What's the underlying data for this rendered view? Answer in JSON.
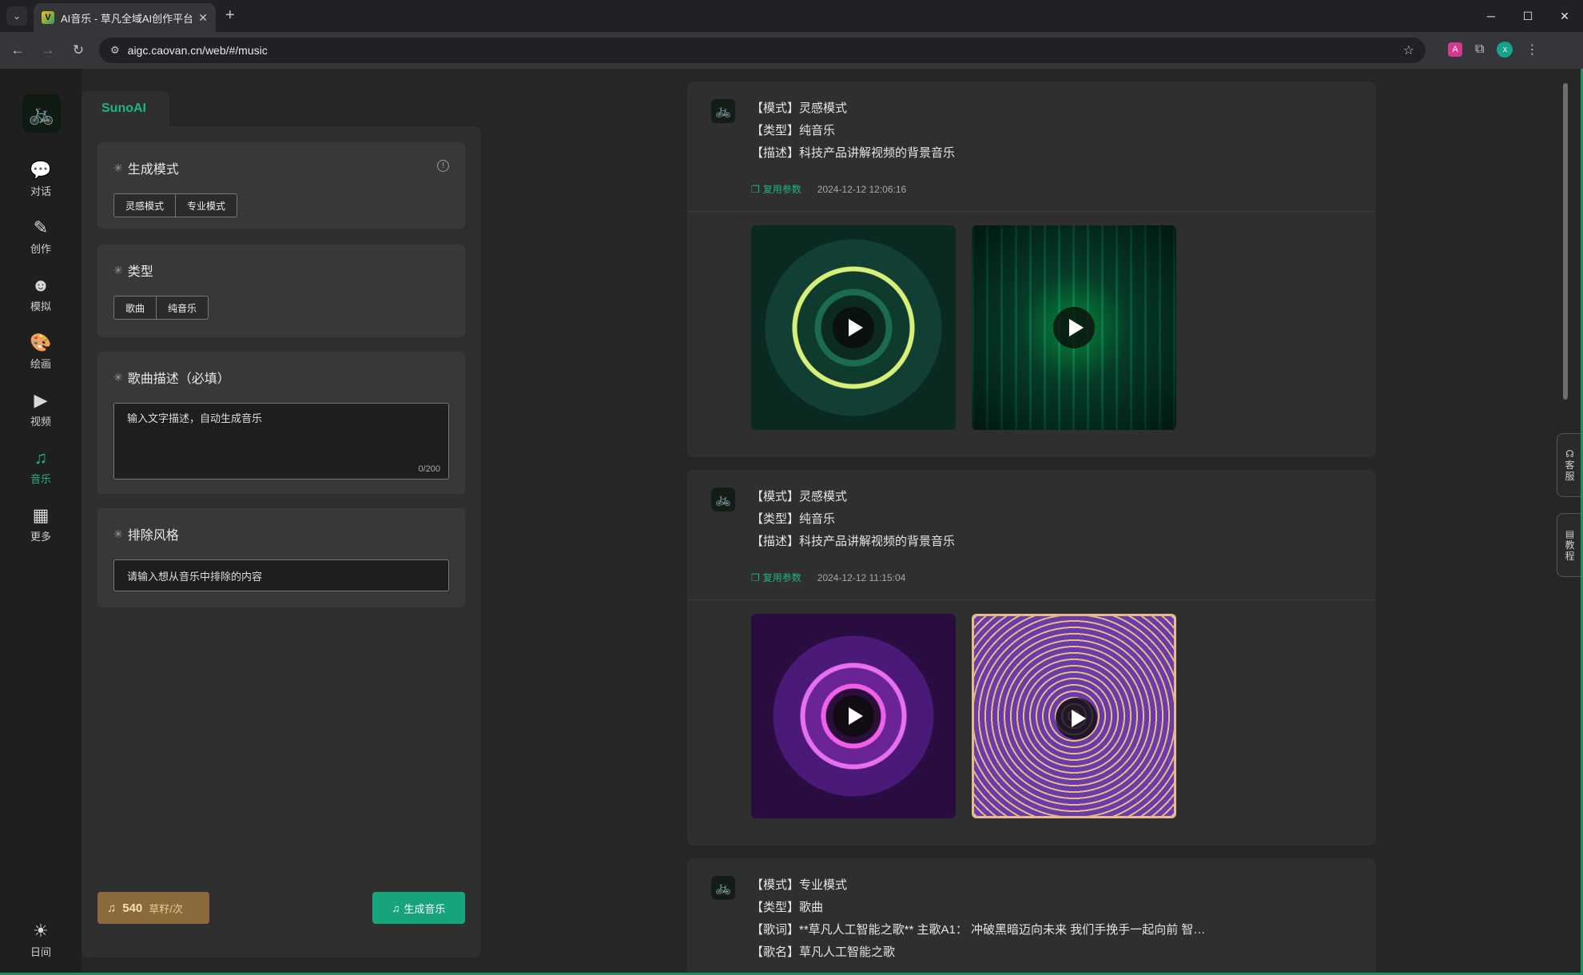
{
  "browser": {
    "tab_title": "AI音乐 - 草凡全域AI创作平台",
    "tab_close": "✕",
    "new_tab": "+",
    "url": "aigc.caovan.cn/web/#/music",
    "profile_initial": "x"
  },
  "nav": {
    "items": [
      {
        "label": "对话",
        "icon": "chat-icon"
      },
      {
        "label": "创作",
        "icon": "feather-icon"
      },
      {
        "label": "模拟",
        "icon": "head-icon"
      },
      {
        "label": "绘画",
        "icon": "palette-icon"
      },
      {
        "label": "视频",
        "icon": "video-icon"
      },
      {
        "label": "音乐",
        "icon": "music-icon"
      },
      {
        "label": "更多",
        "icon": "grid-icon"
      }
    ],
    "bottom_label": "日间"
  },
  "panel": {
    "tab": "SunoAI",
    "mode": {
      "label": "生成模式",
      "options": [
        "灵感模式",
        "专业模式"
      ]
    },
    "type": {
      "label": "类型",
      "options": [
        "歌曲",
        "纯音乐"
      ]
    },
    "desc": {
      "label": "歌曲描述（必填）",
      "placeholder": "输入文字描述，自动生成音乐",
      "count": "0/200"
    },
    "exclude": {
      "label": "排除风格",
      "placeholder": "请输入想从音乐中排除的内容"
    },
    "cost": {
      "amount": "540",
      "unit": "草籽/次"
    },
    "generate_label": "生成音乐"
  },
  "results": [
    {
      "lines": [
        "【模式】灵感模式",
        "【类型】纯音乐",
        "【描述】科技产品讲解视频的背景音乐"
      ],
      "reuse": "复用参数",
      "date": "2024-12-12 12:06:16"
    },
    {
      "lines": [
        "【模式】灵感模式",
        "【类型】纯音乐",
        "【描述】科技产品讲解视频的背景音乐"
      ],
      "reuse": "复用参数",
      "date": "2024-12-12 11:15:04"
    },
    {
      "lines": [
        "【模式】专业模式",
        "【类型】歌曲",
        "【歌词】**草凡人工智能之歌** 主歌A1： 冲破黑暗迈向未来 我们手挽手一起向前 智…",
        "【歌名】草凡人工智能之歌"
      ]
    }
  ],
  "side": {
    "service": [
      "客",
      "服"
    ],
    "tutorial": [
      "教",
      "程"
    ]
  }
}
